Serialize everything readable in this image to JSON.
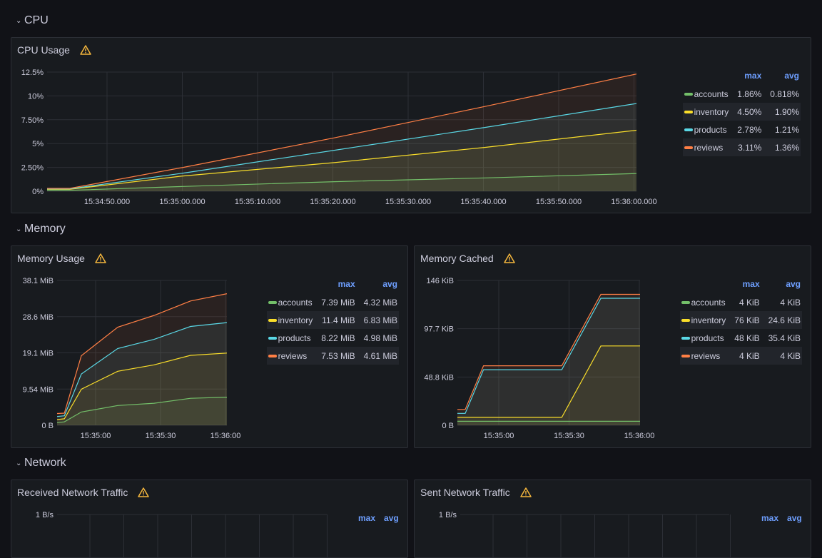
{
  "rows": {
    "cpu": {
      "title": "CPU"
    },
    "memory": {
      "title": "Memory"
    },
    "network": {
      "title": "Network"
    }
  },
  "colors": {
    "accounts": "#73bf69",
    "inventory": "#fade2a",
    "products": "#5ad8e6",
    "reviews": "#ff7f45",
    "warning": "#f5b73d",
    "legend_header": "#6e9fff"
  },
  "panels": {
    "cpu_usage": {
      "title": "CPU Usage",
      "legend": {
        "headers": [
          "max",
          "avg"
        ],
        "rows": [
          {
            "name": "accounts",
            "max": "1.86%",
            "avg": "0.818%"
          },
          {
            "name": "inventory",
            "max": "4.50%",
            "avg": "1.90%"
          },
          {
            "name": "products",
            "max": "2.78%",
            "avg": "1.21%"
          },
          {
            "name": "reviews",
            "max": "3.11%",
            "avg": "1.36%"
          }
        ]
      }
    },
    "memory_usage": {
      "title": "Memory Usage",
      "legend": {
        "headers": [
          "max",
          "avg"
        ],
        "rows": [
          {
            "name": "accounts",
            "max": "7.39 MiB",
            "avg": "4.32 MiB"
          },
          {
            "name": "inventory",
            "max": "11.4 MiB",
            "avg": "6.83 MiB"
          },
          {
            "name": "products",
            "max": "8.22 MiB",
            "avg": "4.98 MiB"
          },
          {
            "name": "reviews",
            "max": "7.53 MiB",
            "avg": "4.61 MiB"
          }
        ]
      }
    },
    "memory_cached": {
      "title": "Memory Cached",
      "legend": {
        "headers": [
          "max",
          "avg"
        ],
        "rows": [
          {
            "name": "accounts",
            "max": "4 KiB",
            "avg": "4 KiB"
          },
          {
            "name": "inventory",
            "max": "76 KiB",
            "avg": "24.6 KiB"
          },
          {
            "name": "products",
            "max": "48 KiB",
            "avg": "35.4 KiB"
          },
          {
            "name": "reviews",
            "max": "4 KiB",
            "avg": "4 KiB"
          }
        ]
      }
    },
    "received_network": {
      "title": "Received Network Traffic",
      "legend": {
        "headers": [
          "max",
          "avg"
        ]
      }
    },
    "sent_network": {
      "title": "Sent Network Traffic",
      "legend": {
        "headers": [
          "max",
          "avg"
        ]
      }
    }
  },
  "chart_data": [
    {
      "id": "cpu_usage",
      "type": "area",
      "title": "CPU Usage",
      "x": [
        "15:34:42",
        "15:34:45",
        "15:35:00",
        "15:35:20",
        "15:35:40",
        "15:36:00"
      ],
      "x_tick_labels": [
        "15:34:50.000",
        "15:35:00.000",
        "15:35:10.000",
        "15:35:20.000",
        "15:35:30.000",
        "15:35:40.000",
        "15:35:50.000",
        "15:36:00.000"
      ],
      "y_tick_labels": [
        "0%",
        "2.50%",
        "5%",
        "7.50%",
        "10%",
        "12.5%"
      ],
      "ylim": [
        0,
        12.5
      ],
      "y_unit": "%",
      "series": [
        {
          "name": "accounts",
          "values": [
            0.1,
            0.1,
            0.5,
            1.0,
            1.4,
            1.86
          ]
        },
        {
          "name": "inventory",
          "values": [
            0.2,
            0.2,
            1.6,
            3.0,
            4.6,
            6.4
          ]
        },
        {
          "name": "products",
          "values": [
            0.25,
            0.25,
            1.9,
            4.3,
            6.7,
            9.2
          ]
        },
        {
          "name": "reviews",
          "values": [
            0.3,
            0.3,
            2.5,
            5.6,
            8.9,
            12.3
          ]
        }
      ]
    },
    {
      "id": "memory_usage",
      "type": "area",
      "title": "Memory Usage",
      "x": [
        "15:34:50",
        "15:34:53",
        "15:35:00",
        "15:35:15",
        "15:35:30",
        "15:35:45",
        "15:36:00"
      ],
      "x_tick_labels": [
        "15:35:00",
        "15:35:30",
        "15:36:00"
      ],
      "y_tick_labels": [
        "0 B",
        "9.54 MiB",
        "19.1 MiB",
        "28.6 MiB",
        "38.1 MiB"
      ],
      "ylim": [
        0,
        38.1
      ],
      "y_unit": "MiB",
      "series": [
        {
          "name": "accounts",
          "values": [
            0.7,
            0.9,
            3.5,
            5.2,
            5.8,
            7.1,
            7.4
          ]
        },
        {
          "name": "inventory",
          "values": [
            1.5,
            1.7,
            9.5,
            14.2,
            15.9,
            18.4,
            19.0
          ]
        },
        {
          "name": "products",
          "values": [
            2.3,
            2.5,
            13.5,
            20.2,
            22.6,
            26.0,
            27.0
          ]
        },
        {
          "name": "reviews",
          "values": [
            3.1,
            3.2,
            18.3,
            25.8,
            28.9,
            32.7,
            34.6
          ]
        }
      ]
    },
    {
      "id": "memory_cached",
      "type": "area",
      "title": "Memory Cached",
      "x": [
        "15:34:50",
        "15:34:53",
        "15:35:00",
        "15:35:30",
        "15:35:45",
        "15:36:00"
      ],
      "x_tick_labels": [
        "15:35:00",
        "15:35:30",
        "15:36:00"
      ],
      "y_tick_labels": [
        "0 B",
        "48.8 KiB",
        "97.7 KiB",
        "146 KiB"
      ],
      "ylim": [
        0,
        146
      ],
      "y_unit": "KiB",
      "series": [
        {
          "name": "accounts",
          "values": [
            4,
            4,
            4,
            4,
            4,
            4
          ]
        },
        {
          "name": "inventory",
          "values": [
            8,
            8,
            8,
            8,
            80,
            80
          ]
        },
        {
          "name": "products",
          "values": [
            12,
            12,
            56,
            56,
            128,
            128
          ]
        },
        {
          "name": "reviews",
          "values": [
            16,
            16,
            60,
            60,
            132,
            132
          ]
        }
      ]
    },
    {
      "id": "received_network",
      "type": "area",
      "title": "Received Network Traffic",
      "y_tick_labels": [
        "1 B/s"
      ],
      "series": []
    },
    {
      "id": "sent_network",
      "type": "area",
      "title": "Sent Network Traffic",
      "y_tick_labels": [
        "1 B/s"
      ],
      "series": []
    }
  ]
}
